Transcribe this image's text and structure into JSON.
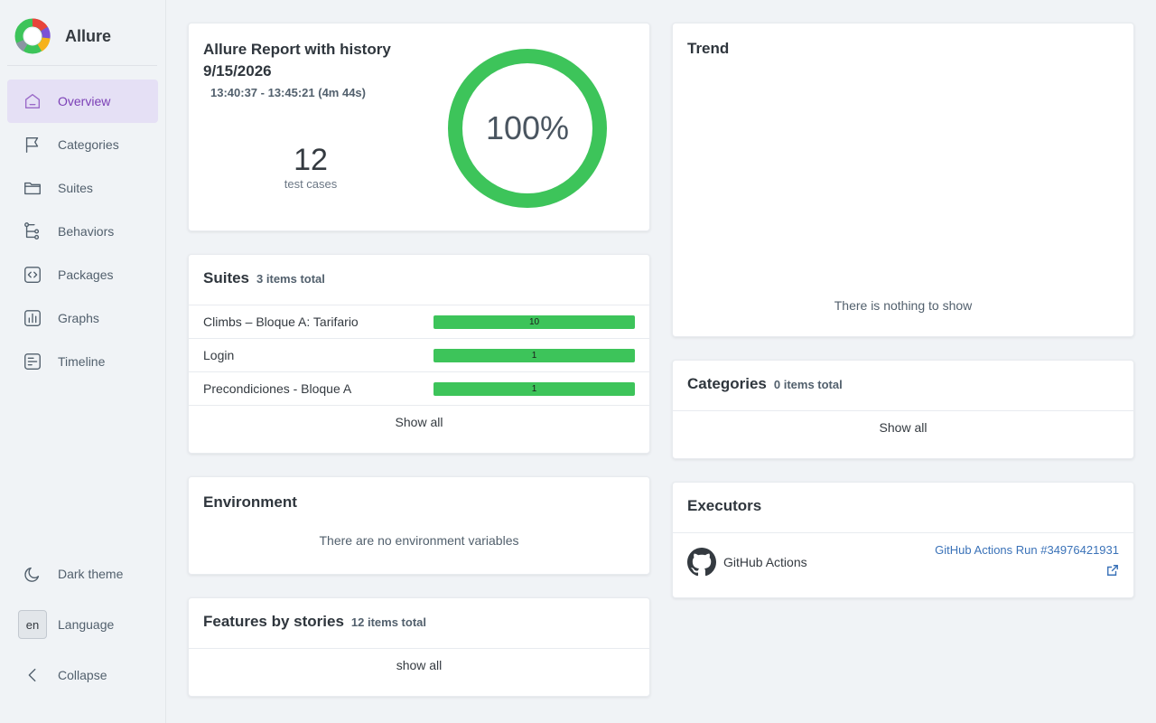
{
  "brand": {
    "name": "Allure"
  },
  "nav": {
    "items": [
      {
        "label": "Overview",
        "icon": "home-icon",
        "active": true
      },
      {
        "label": "Categories",
        "icon": "flag-icon"
      },
      {
        "label": "Suites",
        "icon": "folder-icon"
      },
      {
        "label": "Behaviors",
        "icon": "tree-icon"
      },
      {
        "label": "Packages",
        "icon": "code-icon"
      },
      {
        "label": "Graphs",
        "icon": "bar-chart-icon"
      },
      {
        "label": "Timeline",
        "icon": "timeline-icon"
      }
    ],
    "bottom": {
      "dark_theme": "Dark theme",
      "language_code": "en",
      "language": "Language",
      "collapse": "Collapse"
    }
  },
  "summary": {
    "title": "Allure Report with history 9/15/2026",
    "time": "13:40:37 - 13:45:21 (4m 44s)",
    "count": "12",
    "count_label": "test cases",
    "percent": "100%",
    "pass_fraction": 1.0
  },
  "suites": {
    "title": "Suites",
    "subtitle": "3 items total",
    "rows": [
      {
        "name": "Climbs – Bloque A: Tarifario",
        "passed": "10"
      },
      {
        "name": "Login",
        "passed": "1"
      },
      {
        "name": "Precondiciones - Bloque A",
        "passed": "1"
      }
    ],
    "show_all": "Show all"
  },
  "environment": {
    "title": "Environment",
    "empty": "There are no environment variables"
  },
  "features": {
    "title": "Features by stories",
    "subtitle": "12 items total",
    "show_all": "show all"
  },
  "trend": {
    "title": "Trend",
    "empty": "There is nothing to show"
  },
  "categories": {
    "title": "Categories",
    "subtitle": "0 items total",
    "show_all": "Show all"
  },
  "executors": {
    "title": "Executors",
    "name": "GitHub Actions",
    "link": "GitHub Actions Run #34976421931"
  },
  "colors": {
    "passed": "#3dc45a",
    "accent": "#7b3fb6",
    "link": "#3a72b8"
  }
}
